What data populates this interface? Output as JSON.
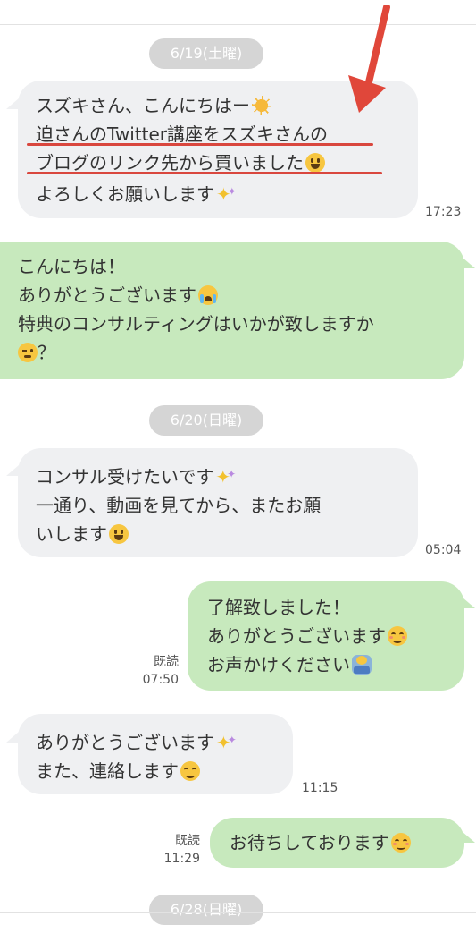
{
  "dates": [
    "6/19(土曜)",
    "6/20(日曜)",
    "6/28(日曜)"
  ],
  "messages": [
    {
      "side": "in",
      "lines": [
        "スズキさん、こんにちはー",
        "迫さんのTwitter講座をスズキさんの",
        "ブログのリンク先から買いました",
        "よろしくお願いします"
      ],
      "time": "17:23"
    },
    {
      "side": "out",
      "lines": [
        "こんにちは！",
        "ありがとうございます",
        "特典のコンサルティングはいかが致しますか",
        "？"
      ]
    },
    {
      "side": "in",
      "lines": [
        "コンサル受けたいです",
        "一通り、動画を見てから、またお願",
        "いします"
      ],
      "time": "05:04"
    },
    {
      "side": "out",
      "lines": [
        "了解致しました！",
        "ありがとうございます",
        "お声かけください"
      ],
      "read": "既読",
      "time": "07:50"
    },
    {
      "side": "in",
      "lines": [
        "ありがとうございます",
        "また、連絡します"
      ],
      "time": "11:15"
    },
    {
      "side": "out",
      "lines": [
        "お待ちしております"
      ],
      "read": "既読",
      "time": "11:29"
    }
  ],
  "colors": {
    "incoming": "#eff0f2",
    "outgoing": "#c7e9bd",
    "date_pill": "#d5d5d5",
    "annotation": "#e0473a"
  },
  "icons": [
    "sun-emoji",
    "grinning-face-emoji",
    "sparkles-emoji",
    "crying-face-emoji",
    "winking-face-emoji",
    "smiling-face-emoji",
    "bowing-person-emoji",
    "red-arrow-annotation"
  ]
}
